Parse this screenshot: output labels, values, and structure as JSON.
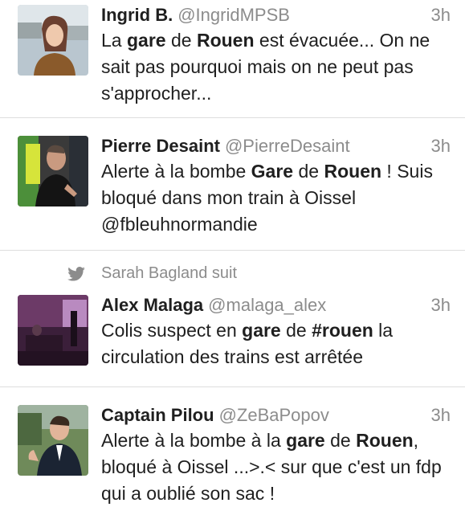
{
  "tweets": [
    {
      "name": "Ingrid B.",
      "handle": "@IngridMPSB",
      "time": "3h",
      "segments": [
        {
          "t": "La "
        },
        {
          "t": "gare",
          "b": true
        },
        {
          "t": " de "
        },
        {
          "t": "Rouen",
          "b": true
        },
        {
          "t": " est évacuée... On ne sait pas pourquoi mais on ne peut pas s'approcher..."
        }
      ]
    },
    {
      "name": "Pierre Desaint",
      "handle": "@PierreDesaint",
      "time": "3h",
      "segments": [
        {
          "t": "Alerte à la bombe "
        },
        {
          "t": "Gare",
          "b": true
        },
        {
          "t": " de "
        },
        {
          "t": "Rouen",
          "b": true
        },
        {
          "t": " ! Suis bloqué dans mon train à Oissel @fbleuhnormandie"
        }
      ]
    },
    {
      "context": "Sarah Bagland  suit",
      "name": "Alex Malaga",
      "handle": "@malaga_alex",
      "time": "3h",
      "segments": [
        {
          "t": "Colis suspect en "
        },
        {
          "t": "gare",
          "b": true
        },
        {
          "t": " de "
        },
        {
          "t": "#rouen",
          "b": true
        },
        {
          "t": " la circulation des trains est arrêtée"
        }
      ]
    },
    {
      "name": "Captain Pilou",
      "handle": "@ZeBaPopov",
      "time": "3h",
      "segments": [
        {
          "t": "Alerte à la bombe à la "
        },
        {
          "t": "gare",
          "b": true
        },
        {
          "t": " de "
        },
        {
          "t": "Rouen",
          "b": true
        },
        {
          "t": ", bloqué à Oissel ...>.< sur que c'est un fdp qui a oublié son sac !"
        }
      ]
    }
  ],
  "icons": {
    "context": "twitter-bird-icon",
    "avatars": [
      "avatar-photo-ingrid",
      "avatar-photo-pierre",
      "avatar-photo-alex",
      "avatar-photo-pilou"
    ]
  },
  "colors": {
    "secondary_text": "#8c8c8c",
    "primary_text": "#1f1f1f",
    "divider": "#dedede",
    "bird": "#8c8c8c"
  }
}
